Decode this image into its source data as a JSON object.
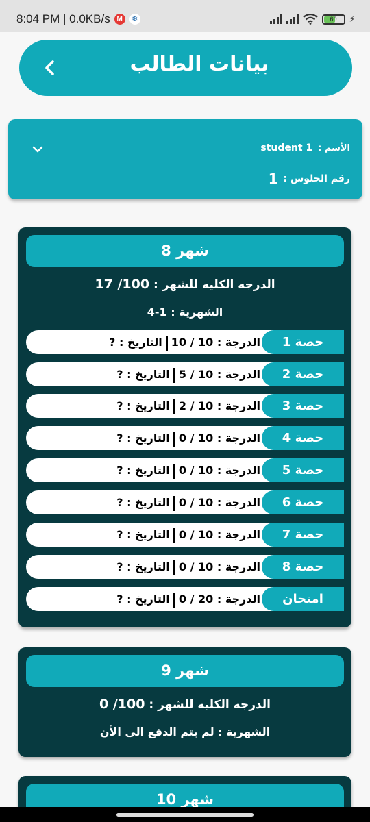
{
  "status_bar": {
    "time_speed": "8:04 PM | 0.0KB/s",
    "mi_icon": "M",
    "snow_icon": "❄",
    "battery_level": "60",
    "battery_fraction": 0.6
  },
  "header": {
    "title": "بيانات الطالب"
  },
  "student": {
    "name_label": "الأسم :",
    "name_value": "student 1",
    "seat_label": "رقم الجلوس :",
    "seat_value": "1"
  },
  "months": [
    {
      "title": "شهر 8",
      "total_label": "الدرجه الكليه للشهر :",
      "total_value": "100/ 17",
      "fees_label": "الشهرية :",
      "fees_value": "1-4",
      "lessons": [
        {
          "name": "حصة 1",
          "grade_label": "الدرجة :",
          "grade": "10 / 10",
          "date_label": "التاريخ :",
          "date": "?"
        },
        {
          "name": "حصة 2",
          "grade_label": "الدرجة :",
          "grade": "10 / 5",
          "date_label": "التاريخ :",
          "date": "?"
        },
        {
          "name": "حصة 3",
          "grade_label": "الدرجة :",
          "grade": "10 / 2",
          "date_label": "التاريخ :",
          "date": "?"
        },
        {
          "name": "حصة 4",
          "grade_label": "الدرجة :",
          "grade": "10 / 0",
          "date_label": "التاريخ :",
          "date": "?"
        },
        {
          "name": "حصة 5",
          "grade_label": "الدرجة :",
          "grade": "10 / 0",
          "date_label": "التاريخ :",
          "date": "?"
        },
        {
          "name": "حصة 6",
          "grade_label": "الدرجة :",
          "grade": "10 / 0",
          "date_label": "التاريخ :",
          "date": "?"
        },
        {
          "name": "حصة 7",
          "grade_label": "الدرجة :",
          "grade": "10 / 0",
          "date_label": "التاريخ :",
          "date": "?"
        },
        {
          "name": "حصة 8",
          "grade_label": "الدرجة :",
          "grade": "10 / 0",
          "date_label": "التاريخ :",
          "date": "?"
        },
        {
          "name": "امتحان",
          "grade_label": "الدرجة :",
          "grade": "20 / 0",
          "date_label": "التاريخ :",
          "date": "?"
        }
      ]
    },
    {
      "title": "شهر 9",
      "total_label": "الدرجه الكليه للشهر :",
      "total_value": "100/ 0",
      "fees_label": "الشهرية :",
      "fees_value": "لم يتم الدفع الي الأن"
    },
    {
      "title": "شهر 10"
    }
  ],
  "colors": {
    "accent": "#11aab9",
    "card_dark": "#073a40",
    "background": "#f7f7f7"
  }
}
